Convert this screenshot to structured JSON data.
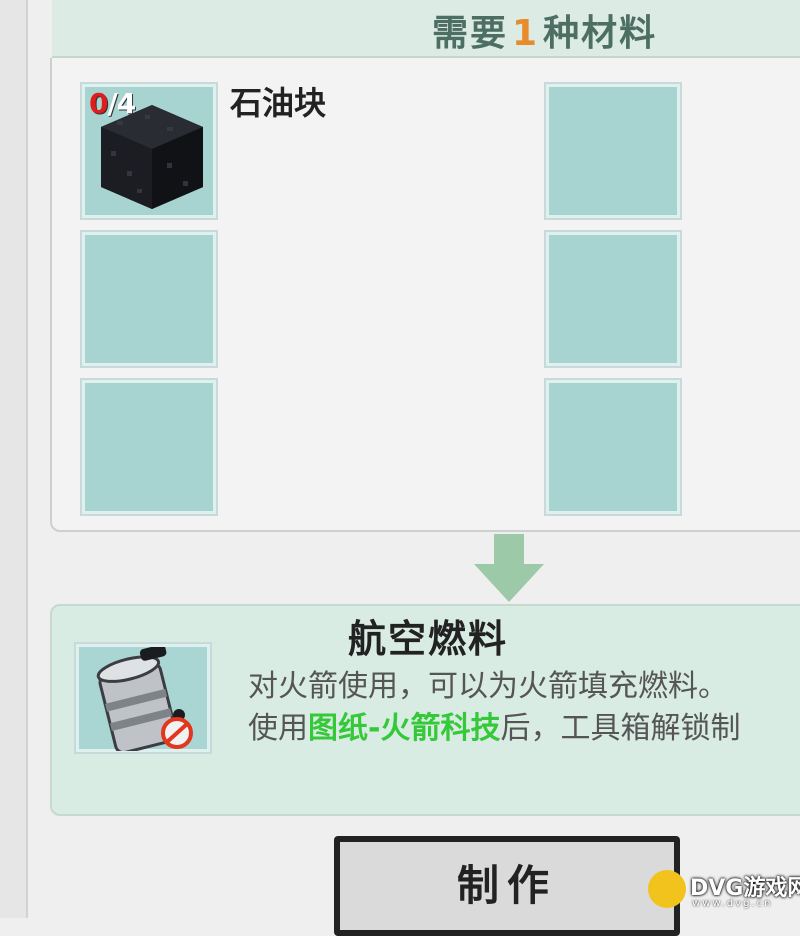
{
  "header": {
    "prefix": "需要",
    "count": "1",
    "suffix": "种材料"
  },
  "materials": [
    {
      "name": "石油块",
      "have": "0",
      "sep_need": "/4",
      "icon": "petroleum-block-icon"
    }
  ],
  "result": {
    "title": "航空燃料",
    "desc_line1": "对火箭使用，可以为火箭填充燃料。",
    "desc_line2_prefix": "使用",
    "desc_line2_highlight": "图纸-火箭科技",
    "desc_line2_suffix": "后，工具箱解锁制",
    "icon": "aviation-fuel-canister-icon"
  },
  "craft_button": {
    "label": "制作"
  },
  "watermark": {
    "text": "DVG游戏网",
    "sub": "www.dvg.cn"
  },
  "colors": {
    "slot": "#a7d4d1",
    "header_band": "#dcebe4",
    "count_accent": "#e78b2c",
    "highlight_green": "#35c93a",
    "have_red": "#e01c1c"
  }
}
